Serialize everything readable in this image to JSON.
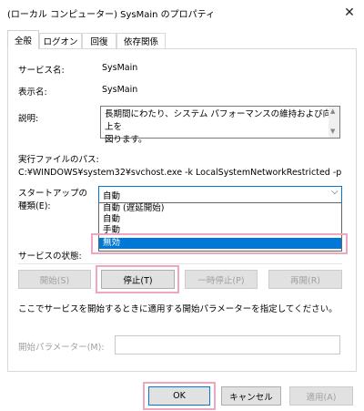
{
  "window": {
    "title": "(ローカル コンピューター) SysMain のプロパティ",
    "close_glyph": "✕"
  },
  "tabs": [
    {
      "label": "全般",
      "active": true
    },
    {
      "label": "ログオン"
    },
    {
      "label": "回復"
    },
    {
      "label": "依存関係"
    }
  ],
  "general": {
    "service_name_label": "サービス名:",
    "service_name_value": "SysMain",
    "display_name_label": "表示名:",
    "display_name_value": "SysMain",
    "description_label": "説明:",
    "description_line1": "長期間にわたり、システム パフォーマンスの維持および向上を",
    "description_line2": "図ります。",
    "exe_path_label": "実行ファイルのパス:",
    "exe_path_value": "C:¥WINDOWS¥system32¥svchost.exe -k LocalSystemNetworkRestricted -p",
    "startup_type_label_line1": "スタートアップの",
    "startup_type_label_line2": "種類(E):",
    "startup_type_value": "自動",
    "startup_options": [
      "自動 (遅延開始)",
      "自動",
      "手動",
      "無効"
    ],
    "startup_selected": "無効",
    "service_status_label": "サービスの状態:",
    "start_button": "開始(S)",
    "stop_button": "停止(T)",
    "pause_button": "一時停止(P)",
    "resume_button": "再開(R)",
    "hint_text": "ここでサービスを開始するときに適用する開始パラメーターを指定してください。",
    "start_params_label": "開始パラメーター(M):"
  },
  "footer": {
    "ok_button": "OK",
    "cancel_button": "キャンセル",
    "apply_button": "適用(A)"
  },
  "colors": {
    "selection": "#0078d7",
    "highlight": "#f0a6c1"
  }
}
